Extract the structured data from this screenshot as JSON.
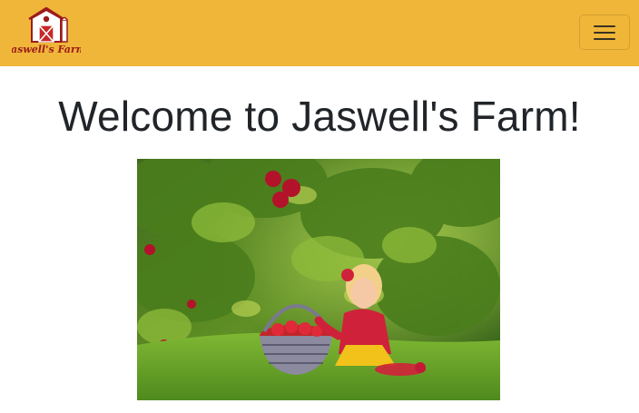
{
  "navbar": {
    "background": "#f0b639",
    "logo": {
      "text": "Jaswell's Farm",
      "icon": "barn-logo"
    },
    "toggle_icon": "hamburger-menu-icon"
  },
  "main": {
    "title": "Welcome to Jaswell's Farm!",
    "hero_image": {
      "subject": "girl-picking-apples-photo"
    }
  }
}
